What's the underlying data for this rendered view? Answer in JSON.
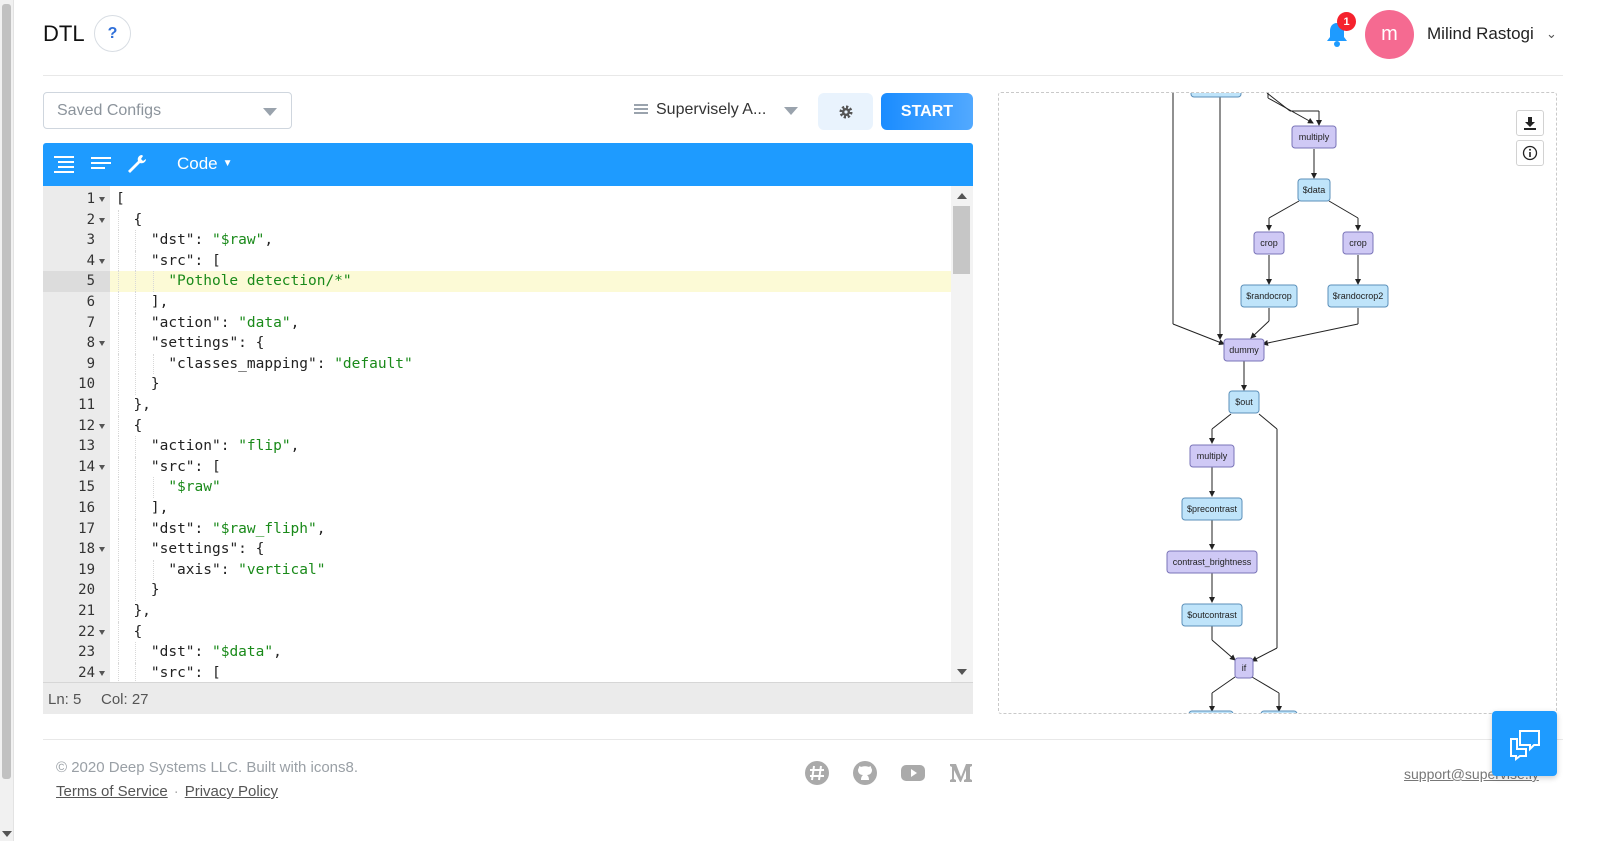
{
  "header": {
    "app_title": "DTL",
    "help_label": "?",
    "notification_count": "1",
    "avatar_initial": "m",
    "user_name": "Milind Rastogi"
  },
  "toolbar": {
    "saved_configs_placeholder": "Saved Configs",
    "agent_select_value": "Supervisely A...",
    "start_label": "START"
  },
  "editor": {
    "mode_label": "Code",
    "status_line": "Ln: 5",
    "status_col": "Col: 27",
    "lines": [
      {
        "n": "1",
        "fold": true,
        "indent": 0,
        "tokens": [
          [
            "p",
            "["
          ]
        ]
      },
      {
        "n": "2",
        "fold": true,
        "indent": 1,
        "tokens": [
          [
            "p",
            "{"
          ]
        ]
      },
      {
        "n": "3",
        "fold": false,
        "indent": 2,
        "tokens": [
          [
            "p",
            "\"dst\": "
          ],
          [
            "s",
            "\"$raw\""
          ],
          [
            "p",
            ","
          ]
        ]
      },
      {
        "n": "4",
        "fold": true,
        "indent": 2,
        "tokens": [
          [
            "p",
            "\"src\": ["
          ]
        ]
      },
      {
        "n": "5",
        "fold": false,
        "indent": 3,
        "tokens": [
          [
            "s",
            "\"Pothole detection/*\""
          ]
        ],
        "active": true
      },
      {
        "n": "6",
        "fold": false,
        "indent": 2,
        "tokens": [
          [
            "p",
            "],"
          ]
        ]
      },
      {
        "n": "7",
        "fold": false,
        "indent": 2,
        "tokens": [
          [
            "p",
            "\"action\": "
          ],
          [
            "s",
            "\"data\""
          ],
          [
            "p",
            ","
          ]
        ]
      },
      {
        "n": "8",
        "fold": true,
        "indent": 2,
        "tokens": [
          [
            "p",
            "\"settings\": {"
          ]
        ]
      },
      {
        "n": "9",
        "fold": false,
        "indent": 3,
        "tokens": [
          [
            "p",
            "\"classes_mapping\": "
          ],
          [
            "s",
            "\"default\""
          ]
        ]
      },
      {
        "n": "10",
        "fold": false,
        "indent": 2,
        "tokens": [
          [
            "p",
            "}"
          ]
        ]
      },
      {
        "n": "11",
        "fold": false,
        "indent": 1,
        "tokens": [
          [
            "p",
            "},"
          ]
        ]
      },
      {
        "n": "12",
        "fold": true,
        "indent": 1,
        "tokens": [
          [
            "p",
            "{"
          ]
        ]
      },
      {
        "n": "13",
        "fold": false,
        "indent": 2,
        "tokens": [
          [
            "p",
            "\"action\": "
          ],
          [
            "s",
            "\"flip\""
          ],
          [
            "p",
            ","
          ]
        ]
      },
      {
        "n": "14",
        "fold": true,
        "indent": 2,
        "tokens": [
          [
            "p",
            "\"src\": ["
          ]
        ]
      },
      {
        "n": "15",
        "fold": false,
        "indent": 3,
        "tokens": [
          [
            "s",
            "\"$raw\""
          ]
        ]
      },
      {
        "n": "16",
        "fold": false,
        "indent": 2,
        "tokens": [
          [
            "p",
            "],"
          ]
        ]
      },
      {
        "n": "17",
        "fold": false,
        "indent": 2,
        "tokens": [
          [
            "p",
            "\"dst\": "
          ],
          [
            "s",
            "\"$raw_fliph\""
          ],
          [
            "p",
            ","
          ]
        ]
      },
      {
        "n": "18",
        "fold": true,
        "indent": 2,
        "tokens": [
          [
            "p",
            "\"settings\": {"
          ]
        ]
      },
      {
        "n": "19",
        "fold": false,
        "indent": 3,
        "tokens": [
          [
            "p",
            "\"axis\": "
          ],
          [
            "s",
            "\"vertical\""
          ]
        ]
      },
      {
        "n": "20",
        "fold": false,
        "indent": 2,
        "tokens": [
          [
            "p",
            "}"
          ]
        ]
      },
      {
        "n": "21",
        "fold": false,
        "indent": 1,
        "tokens": [
          [
            "p",
            "},"
          ]
        ]
      },
      {
        "n": "22",
        "fold": true,
        "indent": 1,
        "tokens": [
          [
            "p",
            "{"
          ]
        ]
      },
      {
        "n": "23",
        "fold": false,
        "indent": 2,
        "tokens": [
          [
            "p",
            "\"dst\": "
          ],
          [
            "s",
            "\"$data\""
          ],
          [
            "p",
            ","
          ]
        ]
      },
      {
        "n": "24",
        "fold": true,
        "indent": 2,
        "tokens": [
          [
            "p",
            "\"src\": ["
          ]
        ]
      }
    ]
  },
  "graph": {
    "nodes": {
      "multiply_top": "multiply",
      "data": "$data",
      "crop1": "crop",
      "crop2": "crop",
      "randocrop": "$randocrop",
      "randocrop2": "$randocrop2",
      "dummy": "dummy",
      "out": "$out",
      "multiply_mid": "multiply",
      "precontrast": "$precontrast",
      "contrast": "contrast_brightness",
      "outcontrast": "$outcontrast",
      "if": "if"
    }
  },
  "footer": {
    "copyright": "© 2020 Deep Systems LLC. Built with icons8.",
    "terms": "Terms of Service",
    "separator": "·",
    "privacy": "Privacy Policy",
    "support": "support@supervise.ly"
  },
  "colors": {
    "accent": "#1e9bff",
    "avatar": "#f56a91",
    "badge": "#f5222d",
    "string": "#1a8a1a",
    "node_layer": "#cfc9f5",
    "node_data": "#bfe4fa"
  }
}
